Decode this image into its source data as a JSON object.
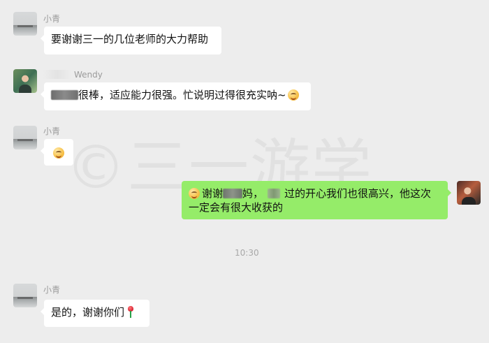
{
  "messages": [
    {
      "sender": "小青",
      "text": "要谢谢三一的几位老师的大力帮助"
    },
    {
      "sender": "Wendy",
      "text_after_blur": "很棒，适应能力很强。忙说明过得很充实呐~"
    },
    {
      "sender": "小青"
    },
    {
      "sender": "me",
      "text_parts": {
        "part1": "谢谢",
        "part2": "妈，",
        "part3": "过的开心我们也很高兴，他这次一定会有很大收获的"
      }
    },
    {
      "sender": "小青",
      "text": "是的，谢谢你们"
    }
  ],
  "time": "10:30",
  "watermark": "©三一游学",
  "colors": {
    "background": "#ededed",
    "bubble_left": "#ffffff",
    "bubble_right": "#95ec69",
    "name": "#9b9b9b",
    "time": "#a8a8a8"
  }
}
